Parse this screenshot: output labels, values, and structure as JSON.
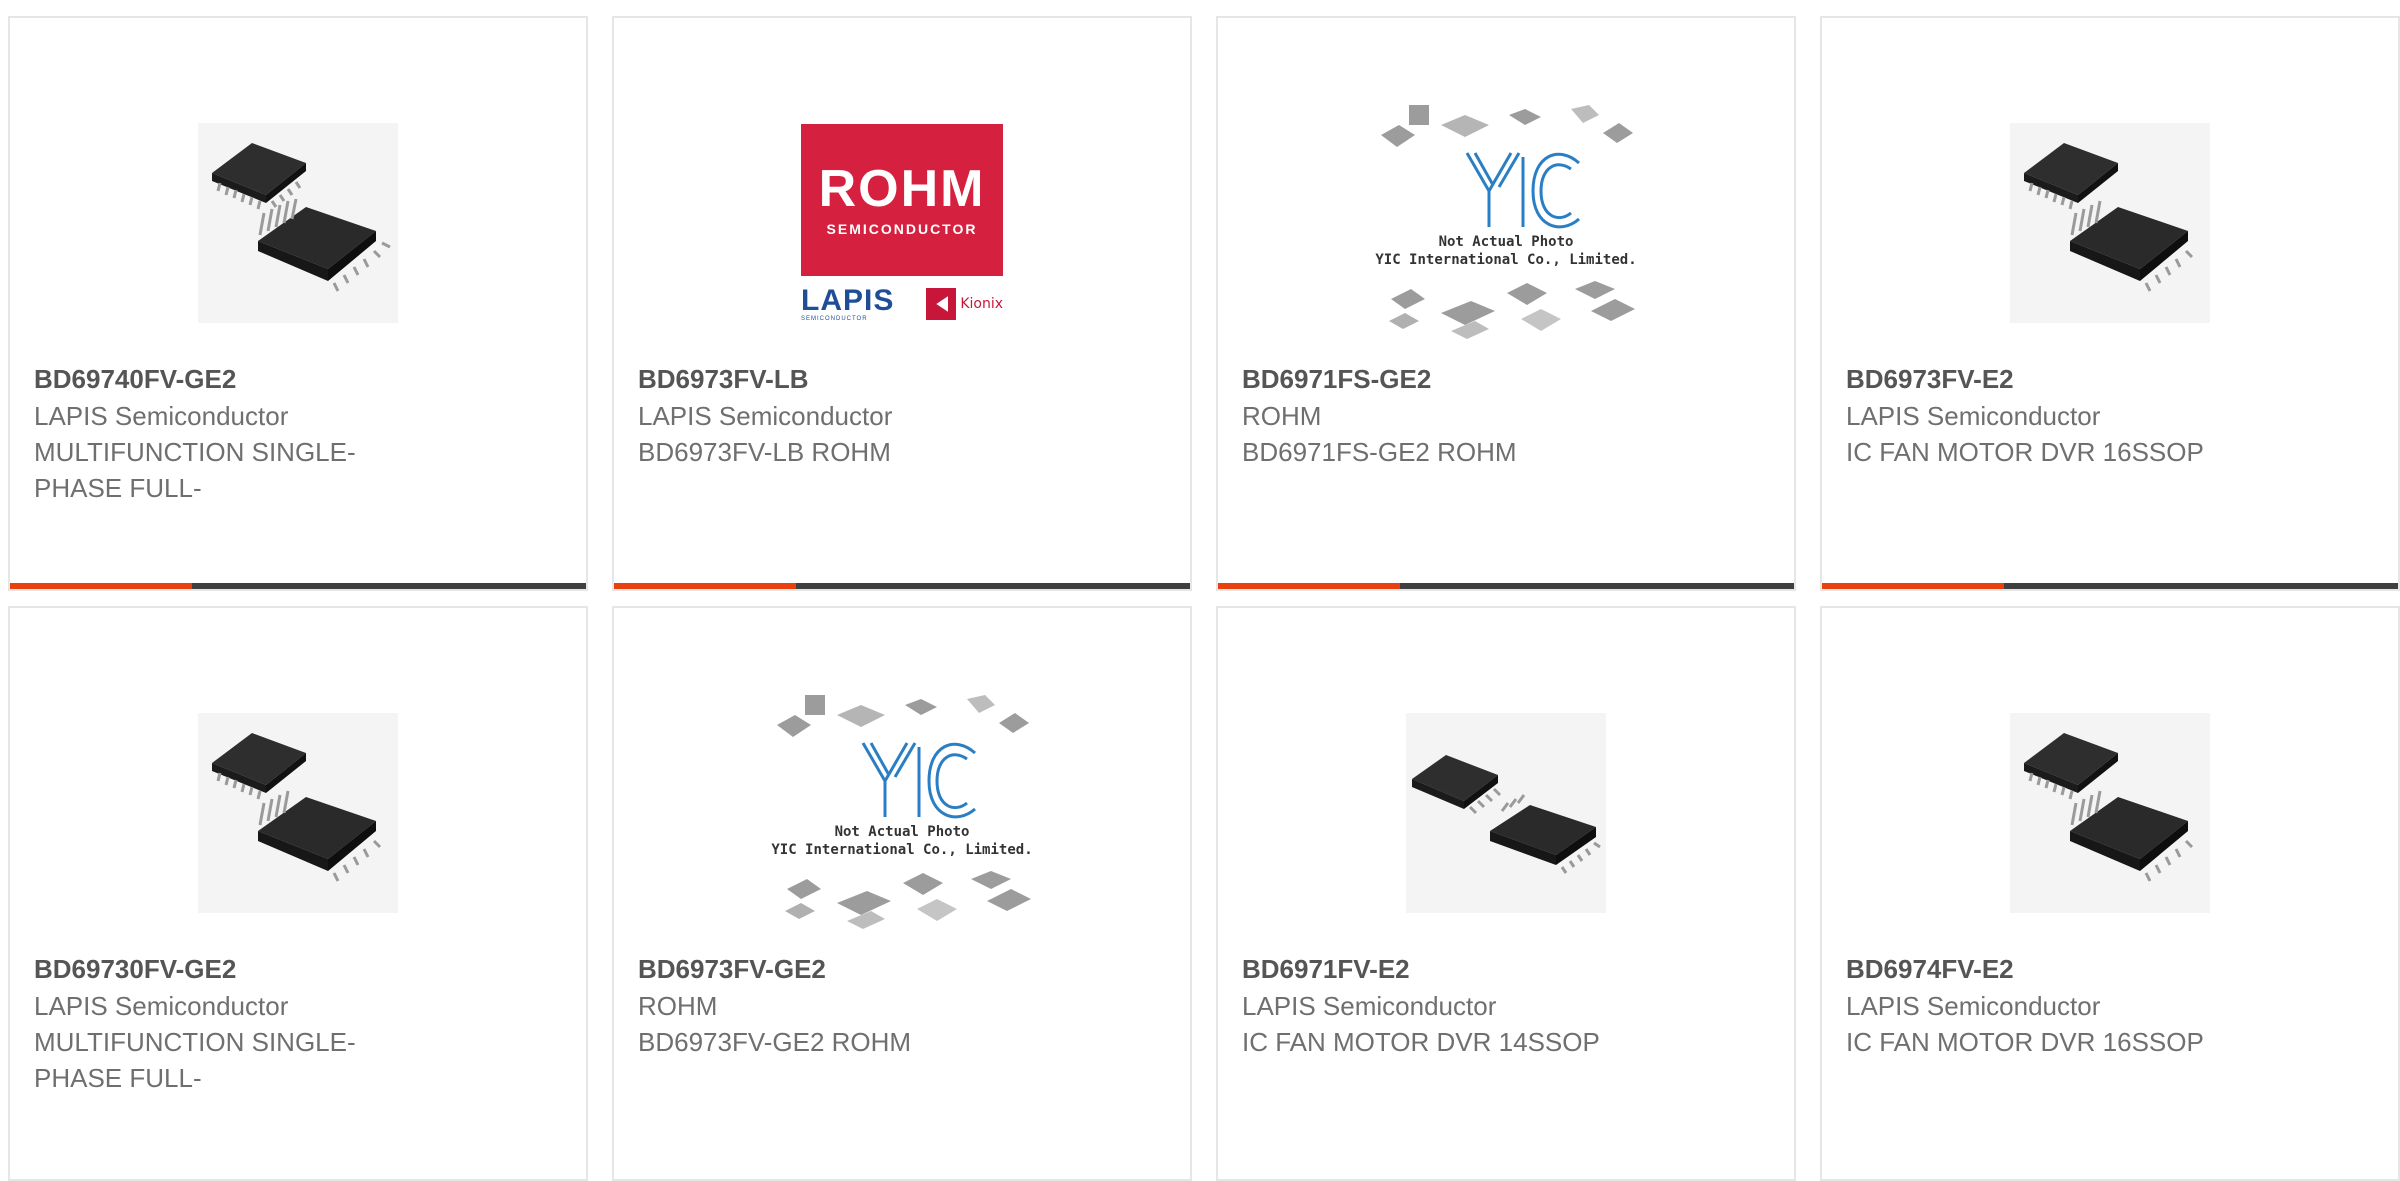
{
  "products": [
    {
      "part": "BD69740FV-GE2",
      "manufacturer": "LAPIS Semiconductor",
      "description": "MULTIFUNCTION SINGLE-PHASE FULL-",
      "image": "ic-chip-photo"
    },
    {
      "part": "BD6973FV-LB",
      "manufacturer": "LAPIS Semiconductor",
      "description": "BD6973FV-LB ROHM",
      "image": "rohm-logo"
    },
    {
      "part": "BD6971FS-GE2",
      "manufacturer": "ROHM",
      "description": "BD6971FS-GE2 ROHM",
      "image": "yic-placeholder"
    },
    {
      "part": "BD6973FV-E2",
      "manufacturer": "LAPIS Semiconductor",
      "description": "IC FAN MOTOR DVR 16SSOP",
      "image": "ic-chip-photo"
    },
    {
      "part": "BD69730FV-GE2",
      "manufacturer": "LAPIS Semiconductor",
      "description": "MULTIFUNCTION SINGLE-PHASE FULL-",
      "image": "ic-chip-photo"
    },
    {
      "part": "BD6973FV-GE2",
      "manufacturer": "ROHM",
      "description": "BD6973FV-GE2 ROHM",
      "image": "yic-placeholder"
    },
    {
      "part": "BD6971FV-E2",
      "manufacturer": "LAPIS Semiconductor",
      "description": "IC FAN MOTOR DVR 14SSOP",
      "image": "ic-chip-photo-small"
    },
    {
      "part": "BD6974FV-E2",
      "manufacturer": "LAPIS Semiconductor",
      "description": "IC FAN MOTOR DVR 16SSOP",
      "image": "ic-chip-photo"
    }
  ],
  "rohm_logo": {
    "brand": "ROHM",
    "sub": "SEMICONDUCTOR",
    "lapis": "LAPIS",
    "lapis_sub": "SEMICONDUCTOR",
    "kionix": "Kionix"
  },
  "yic_placeholder": {
    "line1": "Not Actual Photo",
    "line2": "YIC International Co., Limited."
  },
  "colors": {
    "accent": "#e8410f",
    "bar": "#3f3f3f",
    "rohm_red": "#d5213f",
    "lapis_blue": "#1f4e97",
    "yic_blue": "#2a7fc4"
  }
}
